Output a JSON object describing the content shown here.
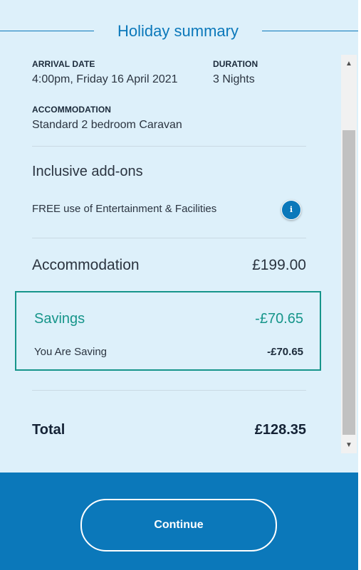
{
  "summary": {
    "title": "Holiday summary",
    "arrival_label": "ARRIVAL DATE",
    "arrival_value": "4:00pm, Friday 16 April 2021",
    "duration_label": "DURATION",
    "duration_value": "3 Nights",
    "accommodation_label": "ACCOMMODATION",
    "accommodation_value": "Standard 2 bedroom Caravan"
  },
  "addons": {
    "title": "Inclusive add-ons",
    "item": "FREE use of Entertainment & Facilities",
    "info_glyph": "i"
  },
  "pricing": {
    "accommodation_label": "Accommodation",
    "accommodation_price": "£199.00",
    "savings_label": "Savings",
    "savings_value": "-£70.65",
    "you_are_saving_label": "You Are Saving",
    "you_are_saving_value": "-£70.65",
    "total_label": "Total",
    "total_value": "£128.35"
  },
  "scrollbar": {
    "up": "▲",
    "down": "▼"
  },
  "footer": {
    "continue_label": "Continue"
  },
  "colors": {
    "accent": "#0b78ba",
    "savings": "#16958a",
    "panel_bg": "#ddf0fa"
  }
}
